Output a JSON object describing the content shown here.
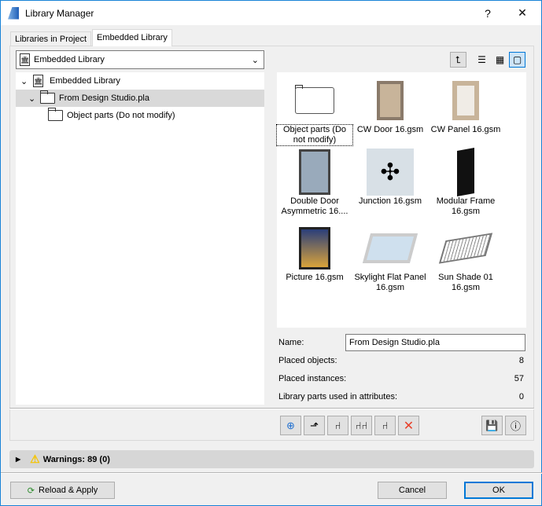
{
  "window": {
    "title": "Library Manager",
    "help": "?",
    "close": "✕"
  },
  "tabs": [
    {
      "label": "Libraries in Project"
    },
    {
      "label": "Embedded Library"
    }
  ],
  "dropdown": {
    "value": "Embedded Library"
  },
  "tree": [
    {
      "label": "Embedded Library"
    },
    {
      "label": "From Design Studio.pla"
    },
    {
      "label": "Object parts (Do not modify)"
    }
  ],
  "grid": [
    {
      "label": "Object parts (Do not modify)"
    },
    {
      "label": "CW Door 16.gsm"
    },
    {
      "label": "CW Panel 16.gsm"
    },
    {
      "label": "Double Door Asymmetric 16...."
    },
    {
      "label": "Junction 16.gsm"
    },
    {
      "label": "Modular Frame 16.gsm"
    },
    {
      "label": "Picture 16.gsm"
    },
    {
      "label": "Skylight Flat Panel 16.gsm"
    },
    {
      "label": "Sun Shade 01 16.gsm"
    }
  ],
  "details": {
    "name_label": "Name:",
    "name_value": "From Design Studio.pla",
    "placed_objects_label": "Placed objects:",
    "placed_objects": "8",
    "placed_instances_label": "Placed instances:",
    "placed_instances": "57",
    "attr_label": "Library parts used in attributes:",
    "attr_value": "0"
  },
  "warnings": {
    "label": "Warnings: 89 (0)"
  },
  "buttons": {
    "reload": "Reload & Apply",
    "cancel": "Cancel",
    "ok": "OK"
  },
  "colors": {
    "accent": "#0078d7",
    "delete": "#e8402a"
  }
}
